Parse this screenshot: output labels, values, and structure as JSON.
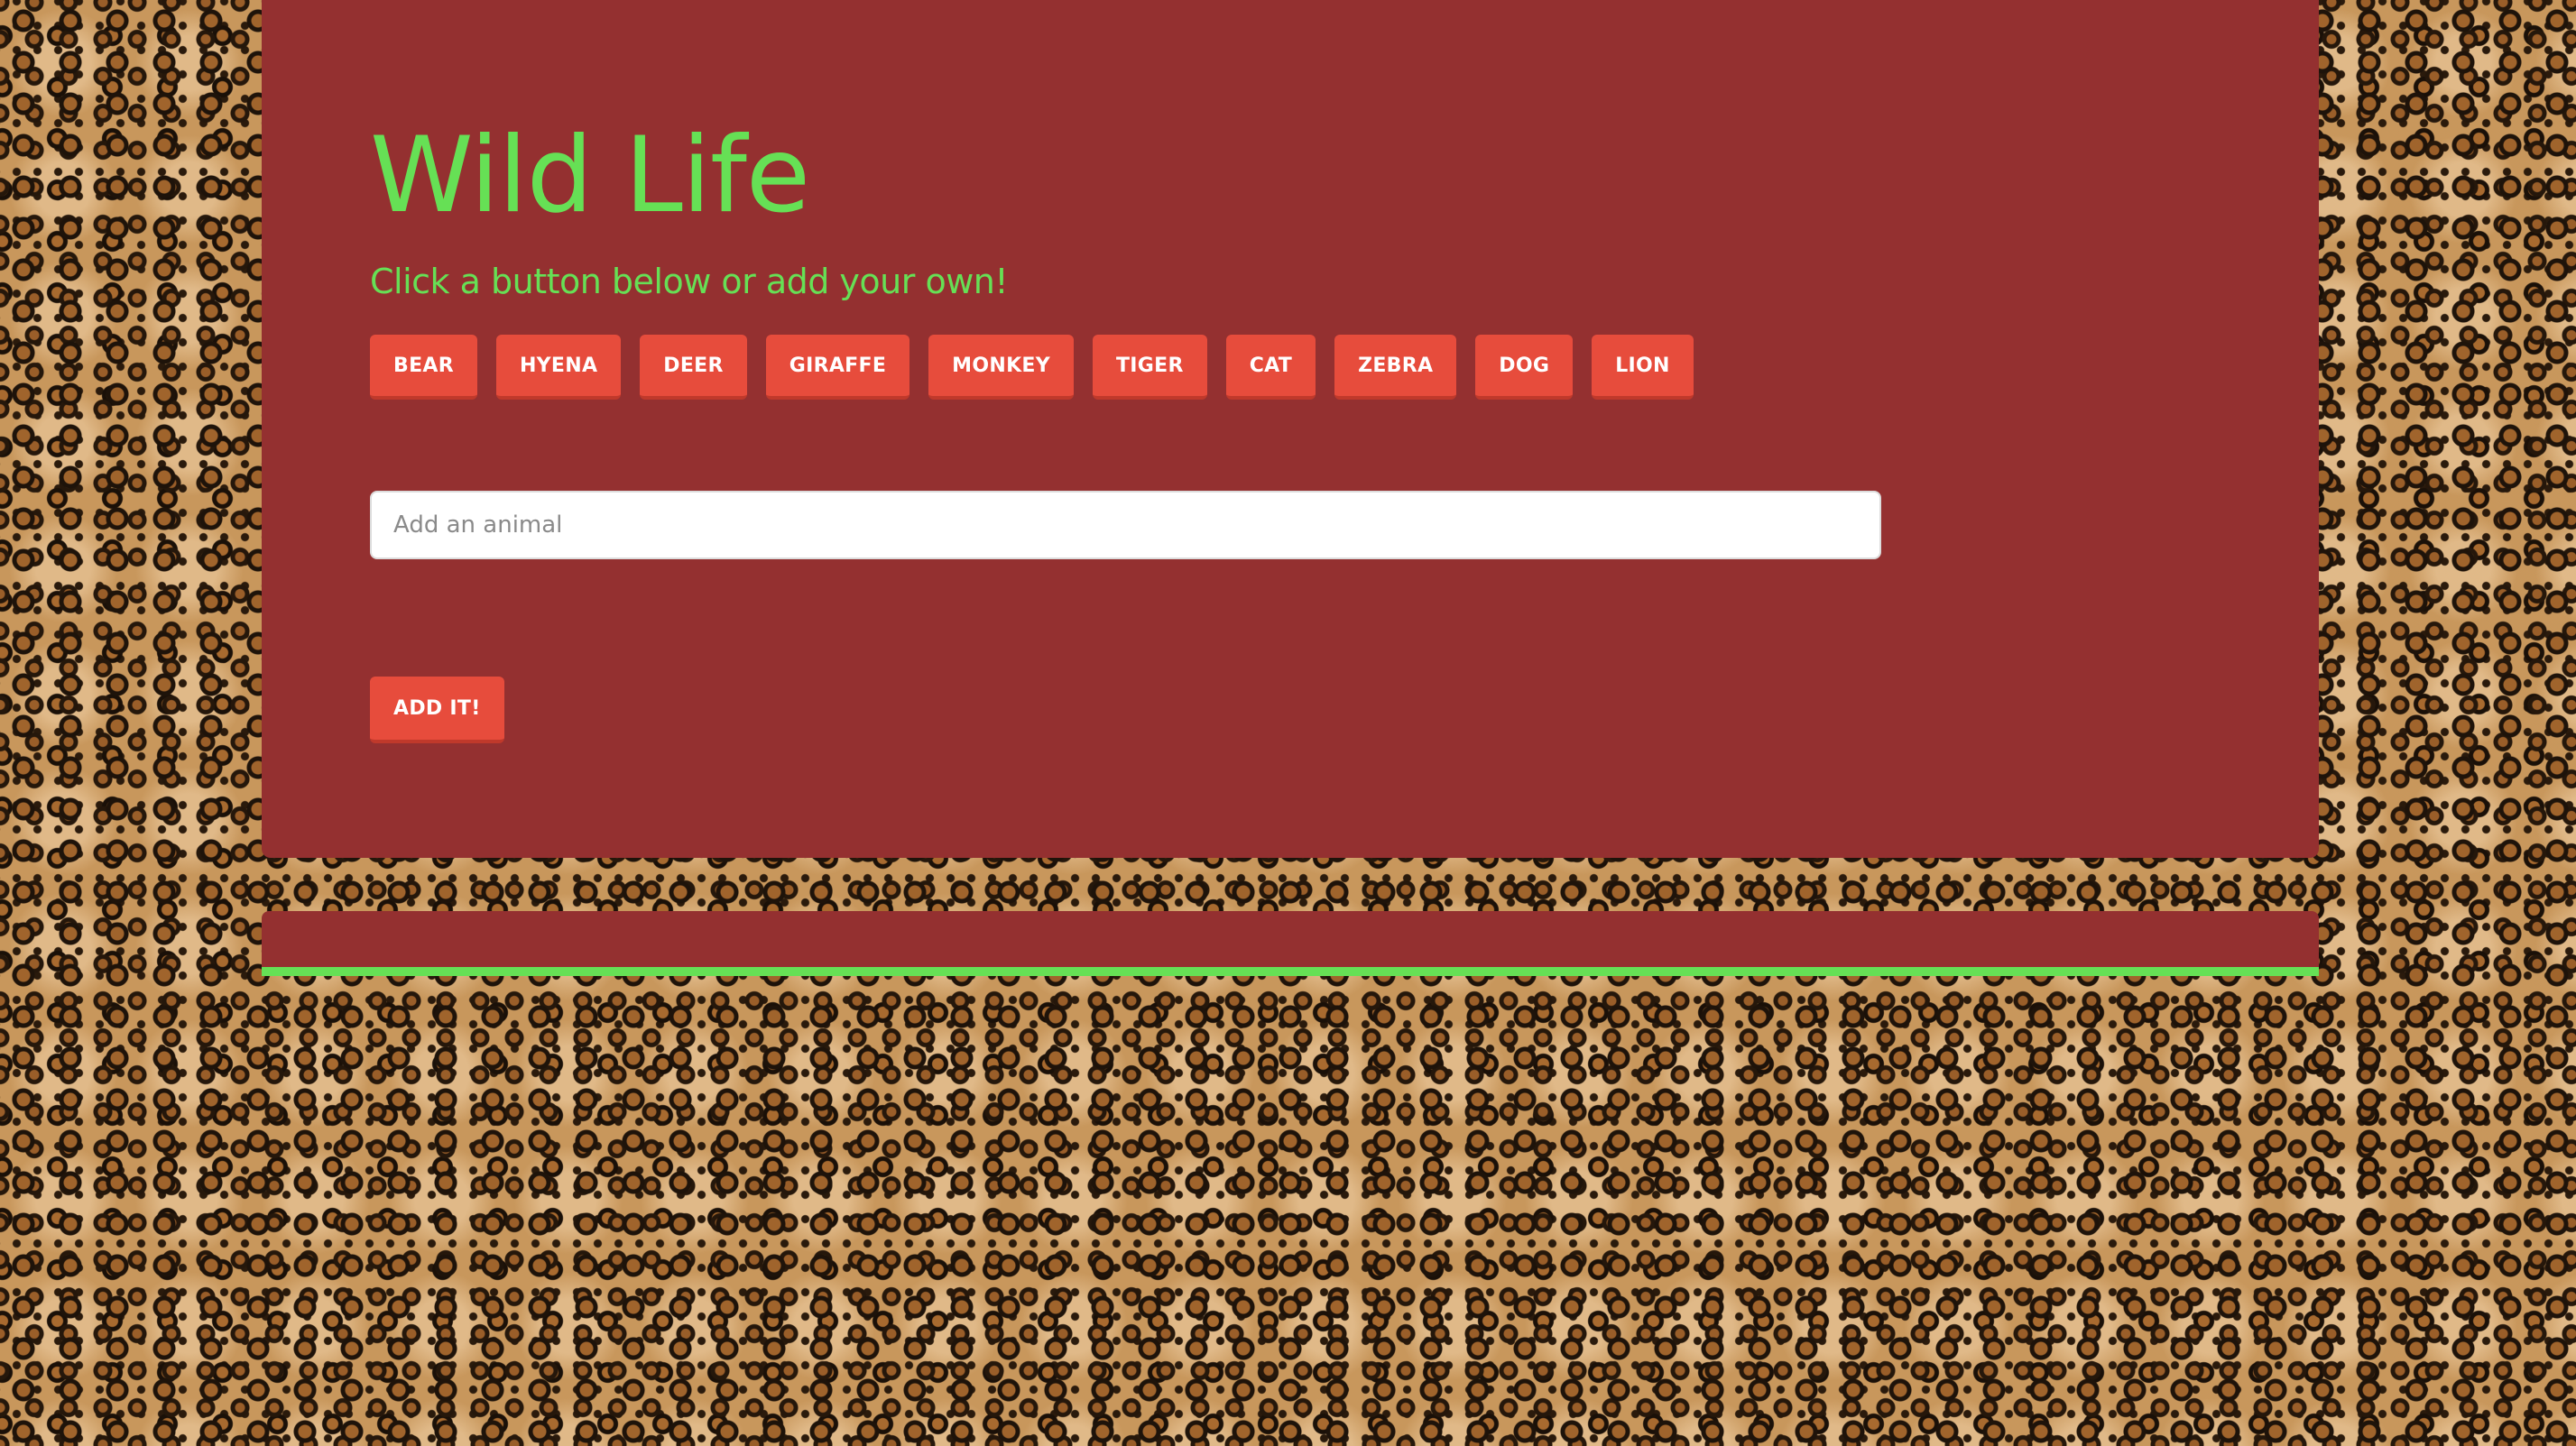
{
  "header": {
    "title": "Wild Life",
    "subtitle": "Click a button below or add your own!"
  },
  "animals": [
    "BEAR",
    "HYENA",
    "DEER",
    "GIRAFFE",
    "MONKEY",
    "TIGER",
    "CAT",
    "ZEBRA",
    "DOG",
    "LION"
  ],
  "form": {
    "input_placeholder": "Add an animal",
    "input_value": "",
    "submit_label": "ADD IT!"
  },
  "colors": {
    "panel_background": "#943030",
    "title_green": "#66e055",
    "button_red": "#e74c3c",
    "button_text": "#ffffff",
    "page_background": "leopard-print pattern"
  }
}
